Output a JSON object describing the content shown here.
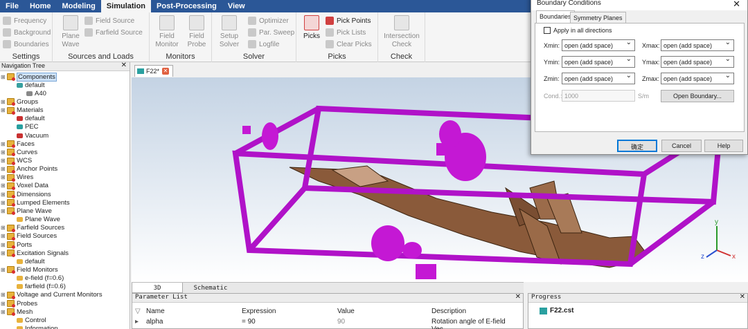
{
  "menu": {
    "items": [
      "File",
      "Home",
      "Modeling",
      "Simulation",
      "Post-Processing",
      "View"
    ],
    "active": "Simulation"
  },
  "ribbon": {
    "settings": {
      "label": "Settings",
      "items": [
        "Frequency",
        "Background",
        "Boundaries"
      ]
    },
    "sources": {
      "label": "Sources and Loads",
      "plane_wave": "Plane\nWave",
      "field_source": "Field Source",
      "farfield_source": "Farfield Source"
    },
    "monitors": {
      "label": "Monitors",
      "field_monitor": "Field\nMonitor",
      "field_probe": "Field\nProbe"
    },
    "solver": {
      "label": "Solver",
      "setup_solver": "Setup\nSolver",
      "optimizer": "Optimizer",
      "par_sweep": "Par. Sweep",
      "logfile": "Logfile"
    },
    "picks": {
      "label": "Picks",
      "picks": "Picks",
      "pick_points": "Pick Points",
      "pick_lists": "Pick Lists",
      "clear_picks": "Clear Picks"
    },
    "check": {
      "label": "Check",
      "intersection_check": "Intersection\nCheck"
    }
  },
  "nav": {
    "title": "Navigation Tree",
    "items": [
      {
        "label": "Components",
        "level": 0,
        "selected": true
      },
      {
        "label": "default",
        "level": 1
      },
      {
        "label": "A40",
        "level": 2
      },
      {
        "label": "Groups",
        "level": 0
      },
      {
        "label": "Materials",
        "level": 0
      },
      {
        "label": "default",
        "level": 1
      },
      {
        "label": "PEC",
        "level": 1
      },
      {
        "label": "Vacuum",
        "level": 1
      },
      {
        "label": "Faces",
        "level": 0
      },
      {
        "label": "Curves",
        "level": 0
      },
      {
        "label": "WCS",
        "level": 0
      },
      {
        "label": "Anchor Points",
        "level": 0
      },
      {
        "label": "Wires",
        "level": 0
      },
      {
        "label": "Voxel Data",
        "level": 0
      },
      {
        "label": "Dimensions",
        "level": 0
      },
      {
        "label": "Lumped Elements",
        "level": 0
      },
      {
        "label": "Plane Wave",
        "level": 0
      },
      {
        "label": "Plane Wave",
        "level": 1
      },
      {
        "label": "Farfield Sources",
        "level": 0
      },
      {
        "label": "Field Sources",
        "level": 0
      },
      {
        "label": "Ports",
        "level": 0
      },
      {
        "label": "Excitation Signals",
        "level": 0
      },
      {
        "label": "default",
        "level": 1
      },
      {
        "label": "Field Monitors",
        "level": 0
      },
      {
        "label": "e-field (f=0.6)",
        "level": 1
      },
      {
        "label": "farfield (f=0.6)",
        "level": 1
      },
      {
        "label": "Voltage and Current Monitors",
        "level": 0
      },
      {
        "label": "Probes",
        "level": 0
      },
      {
        "label": "Mesh",
        "level": 0
      },
      {
        "label": "Control",
        "level": 1
      },
      {
        "label": "Information",
        "level": 1
      }
    ]
  },
  "doc_tab": {
    "label": "F22*"
  },
  "view_tabs": {
    "tab3d": "3D",
    "schematic": "Schematic"
  },
  "axes": {
    "x": "x",
    "y": "y",
    "z": "z"
  },
  "parameters": {
    "title": "Parameter List",
    "headers": {
      "name": "Name",
      "expression": "Expression",
      "value": "Value",
      "description": "Description"
    },
    "rows": [
      {
        "name": "alpha",
        "expression": "= 90",
        "value": "90",
        "description": "Rotation angle of E-field Vec..."
      }
    ]
  },
  "progress": {
    "title": "Progress",
    "file": "F22.cst"
  },
  "dialog": {
    "title": "Boundary Conditions",
    "tabs": [
      "Boundaries",
      "Symmetry Planes"
    ],
    "apply_all": "Apply in all directions",
    "xmin_label": "Xmin:",
    "xmax_label": "Xmax:",
    "ymin_label": "Ymin:",
    "ymax_label": "Ymax:",
    "zmin_label": "Zmin:",
    "zmax_label": "Zmax:",
    "xmin": "open (add space)",
    "xmax": "open (add space)",
    "ymin": "open (add space)",
    "ymax": "open (add space)",
    "zmin": "open (add space)",
    "zmax": "open (add space)",
    "cond_label": "Cond.:",
    "cond_value": "1000",
    "cond_unit": "S/m",
    "open_boundary": "Open Boundary...",
    "ok": "确定",
    "cancel": "Cancel",
    "help": "Help"
  },
  "colors": {
    "menubar": "#2b5797",
    "box": "#b012c8",
    "aircraft": "#8a5a3a"
  }
}
